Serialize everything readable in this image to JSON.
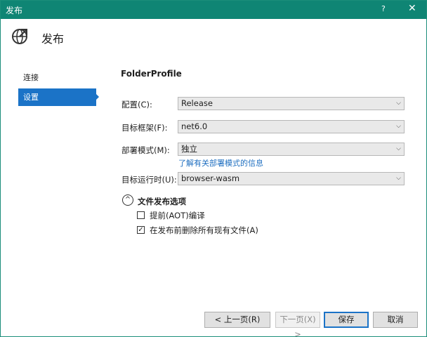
{
  "window": {
    "title": "发布",
    "help": "?",
    "close": "✕"
  },
  "header": {
    "title": "发布",
    "icon": "globe-publish-icon"
  },
  "sidebar": {
    "items": [
      {
        "label": "连接"
      },
      {
        "label": "设置"
      }
    ]
  },
  "main": {
    "profile_name": "FolderProfile",
    "fields": [
      {
        "label": "配置(C):",
        "value": "Release"
      },
      {
        "label": "目标框架(F):",
        "value": "net6.0"
      },
      {
        "label": "部署模式(M):",
        "value": "独立"
      },
      {
        "label": "目标运行时(U):",
        "value": "browser-wasm"
      }
    ],
    "deploy_link": "了解有关部署模式的信息",
    "section": {
      "title": "文件发布选项",
      "toggle": "^"
    },
    "options": [
      {
        "label": "提前(AOT)编译",
        "checked": false
      },
      {
        "label": "在发布前删除所有现有文件(A)",
        "checked": true
      }
    ]
  },
  "footer": {
    "prev": "< 上一页(R)",
    "next": "下一页(X) >",
    "save": "保存",
    "cancel": "取消"
  },
  "colors": {
    "titlebar": "#0f8574",
    "accent": "#1b73c7",
    "link": "#1f6fc0"
  }
}
